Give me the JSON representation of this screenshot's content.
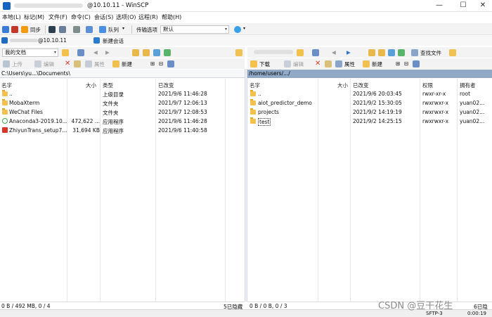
{
  "titlebar": {
    "session": "@10.10.11",
    "title": "@10.10.11 - WinSCP",
    "minimize": "—",
    "maximize": "☐",
    "close": "✕"
  },
  "menu": [
    "本地(L)",
    "标记(M)",
    "文件(F)",
    "命令(C)",
    "会话(S)",
    "选项(O)",
    "远程(R)",
    "帮助(H)"
  ],
  "toolbar": {
    "sync": "同步",
    "queue": "队列",
    "transfer_label": "传输选项",
    "transfer_value": "默认"
  },
  "session_tabs": {
    "current": "@10.10.11",
    "new_session": "新建会话"
  },
  "local": {
    "location": "我的文档",
    "path": "C:\\Users\\yu...\\Documents\\",
    "upload": "上传",
    "edit": "编辑",
    "properties": "属性",
    "new": "新建",
    "columns": {
      "name": "名字",
      "size": "大小",
      "type": "类型",
      "changed": "已改变"
    },
    "rows": [
      {
        "name": "..",
        "size": "",
        "type": "上级目录",
        "changed": "2021/9/6  11:46:28",
        "icon": "folder-up"
      },
      {
        "name": "MobaXterm",
        "size": "",
        "type": "文件夹",
        "changed": "2021/9/7  12:06:13",
        "icon": "folder"
      },
      {
        "name": "WeChat Files",
        "size": "",
        "type": "文件夹",
        "changed": "2021/9/7  12:08:53",
        "icon": "folder"
      },
      {
        "name": "Anaconda3-2019.10...",
        "size": "472,622 ...",
        "type": "应用程序",
        "changed": "2021/9/6  11:46:28",
        "icon": "anaconda"
      },
      {
        "name": "ZhiyunTrans_setup7...",
        "size": "31,694 KB",
        "type": "应用程序",
        "changed": "2021/9/6  11:40:58",
        "icon": "exe"
      }
    ],
    "status": "0 B / 492 MB,  0 / 4",
    "hidden": "5已隐藏"
  },
  "remote": {
    "download": "下载",
    "edit": "编辑",
    "properties": "属性",
    "new": "新建",
    "find": "查找文件",
    "path": "/home/users/.../",
    "columns": {
      "name": "名字",
      "size": "大小",
      "changed": "已改变",
      "rights": "权限",
      "owner": "拥有者"
    },
    "rows": [
      {
        "name": "..",
        "size": "",
        "changed": "2021/9/6 20:03:45",
        "rights": "rwxr-xr-x",
        "owner": "root",
        "icon": "folder-up"
      },
      {
        "name": "aiot_predictor_demo",
        "size": "",
        "changed": "2021/9/2 15:30:05",
        "rights": "rwxrwxr-x",
        "owner": "yuan02...",
        "icon": "folder"
      },
      {
        "name": "projects",
        "size": "",
        "changed": "2021/9/2 14:19:19",
        "rights": "rwxrwxr-x",
        "owner": "yuan02...",
        "icon": "folder"
      },
      {
        "name": "test",
        "size": "",
        "changed": "2021/9/2 14:25:15",
        "rights": "rwxrwxr-x",
        "owner": "yuan02...",
        "icon": "folder"
      }
    ],
    "status": "0 B / 0 B,  0 / 3",
    "hidden": "6已隐藏"
  },
  "bottom": {
    "protocol": "SFTP-3",
    "time": "0:00:19"
  },
  "watermark": "CSDN @豆干花生"
}
